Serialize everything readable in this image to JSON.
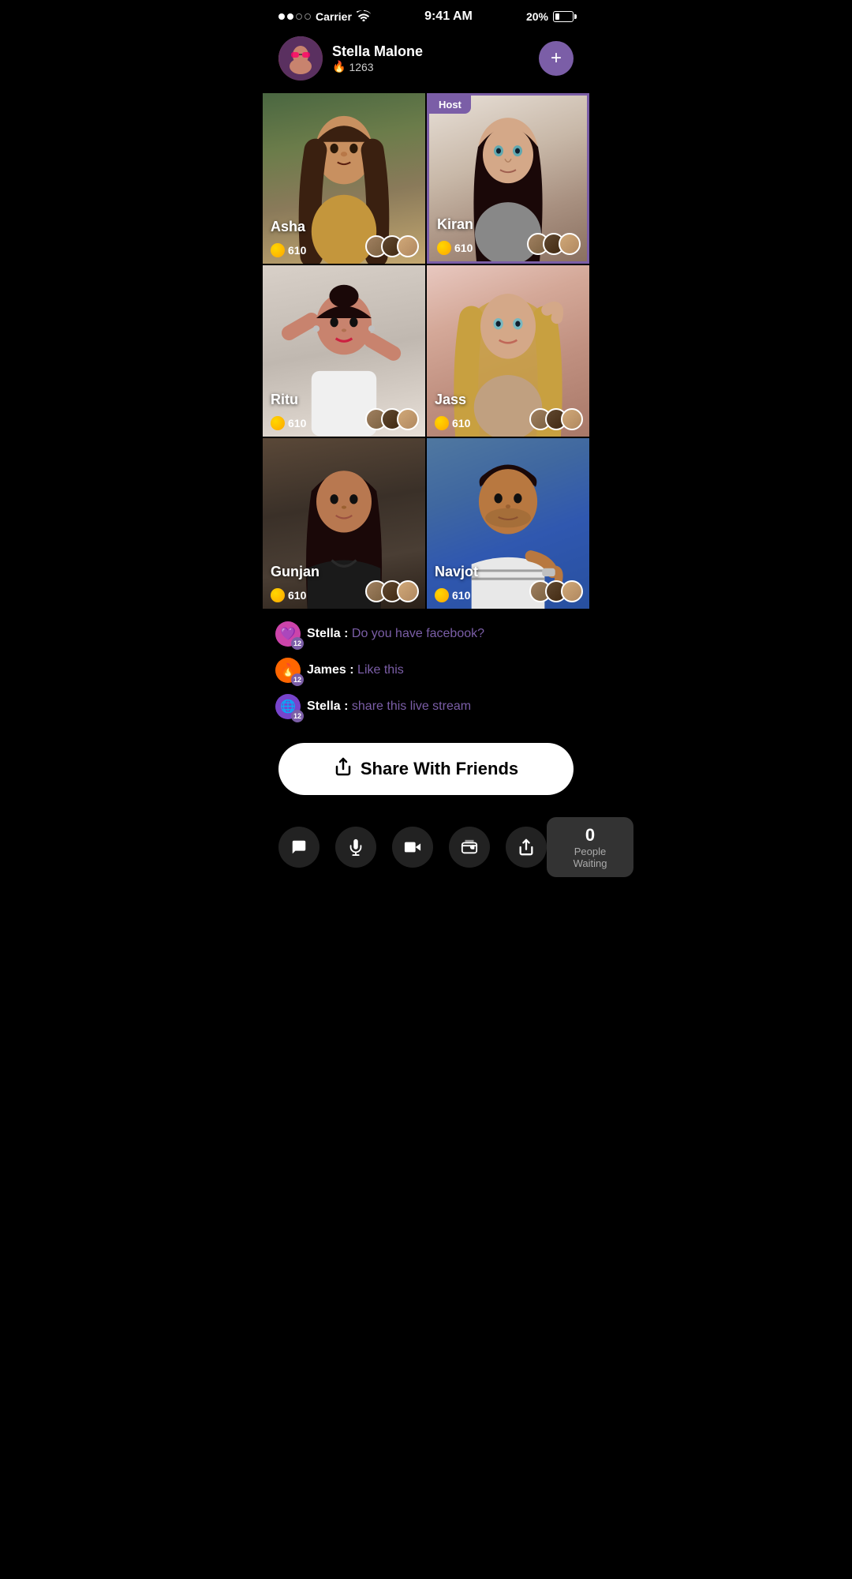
{
  "statusBar": {
    "carrier": "Carrier",
    "time": "9:41 AM",
    "battery": "20%"
  },
  "profile": {
    "name": "Stella Malone",
    "score": "1263",
    "addLabel": "+"
  },
  "grid": {
    "cells": [
      {
        "id": "asha",
        "name": "Asha",
        "coins": "610",
        "isHost": false,
        "bgClass": "bg-asha"
      },
      {
        "id": "kiran",
        "name": "Kiran",
        "coins": "610",
        "isHost": true,
        "bgClass": "bg-kiran",
        "hostLabel": "Host"
      },
      {
        "id": "ritu",
        "name": "Ritu",
        "coins": "610",
        "isHost": false,
        "bgClass": "bg-ritu"
      },
      {
        "id": "jass",
        "name": "Jass",
        "coins": "610",
        "isHost": false,
        "bgClass": "bg-jass"
      },
      {
        "id": "gunjan",
        "name": "Gunjan",
        "coins": "610",
        "isHost": false,
        "bgClass": "bg-gunjan"
      },
      {
        "id": "navjot",
        "name": "Navjot",
        "coins": "610",
        "isHost": false,
        "bgClass": "bg-navjot"
      }
    ]
  },
  "chat": {
    "messages": [
      {
        "user": "Stella",
        "text": "Do you have facebook?",
        "badgeType": "heart",
        "badgeNum": "12"
      },
      {
        "user": "James",
        "text": "Like this",
        "badgeType": "fire",
        "badgeNum": "12"
      },
      {
        "user": "Stella",
        "text": "share this live stream",
        "badgeType": "planet",
        "badgeNum": "12"
      }
    ]
  },
  "shareButton": {
    "label": "Share With Friends"
  },
  "bottomBar": {
    "icons": [
      {
        "id": "chat",
        "symbol": "💬"
      },
      {
        "id": "mic",
        "symbol": "🎤"
      },
      {
        "id": "video",
        "symbol": "🎥"
      },
      {
        "id": "wallet",
        "symbol": "👝"
      },
      {
        "id": "share",
        "symbol": "↗"
      }
    ],
    "peopleWaiting": {
      "count": "0",
      "label": "People Waiting"
    }
  }
}
